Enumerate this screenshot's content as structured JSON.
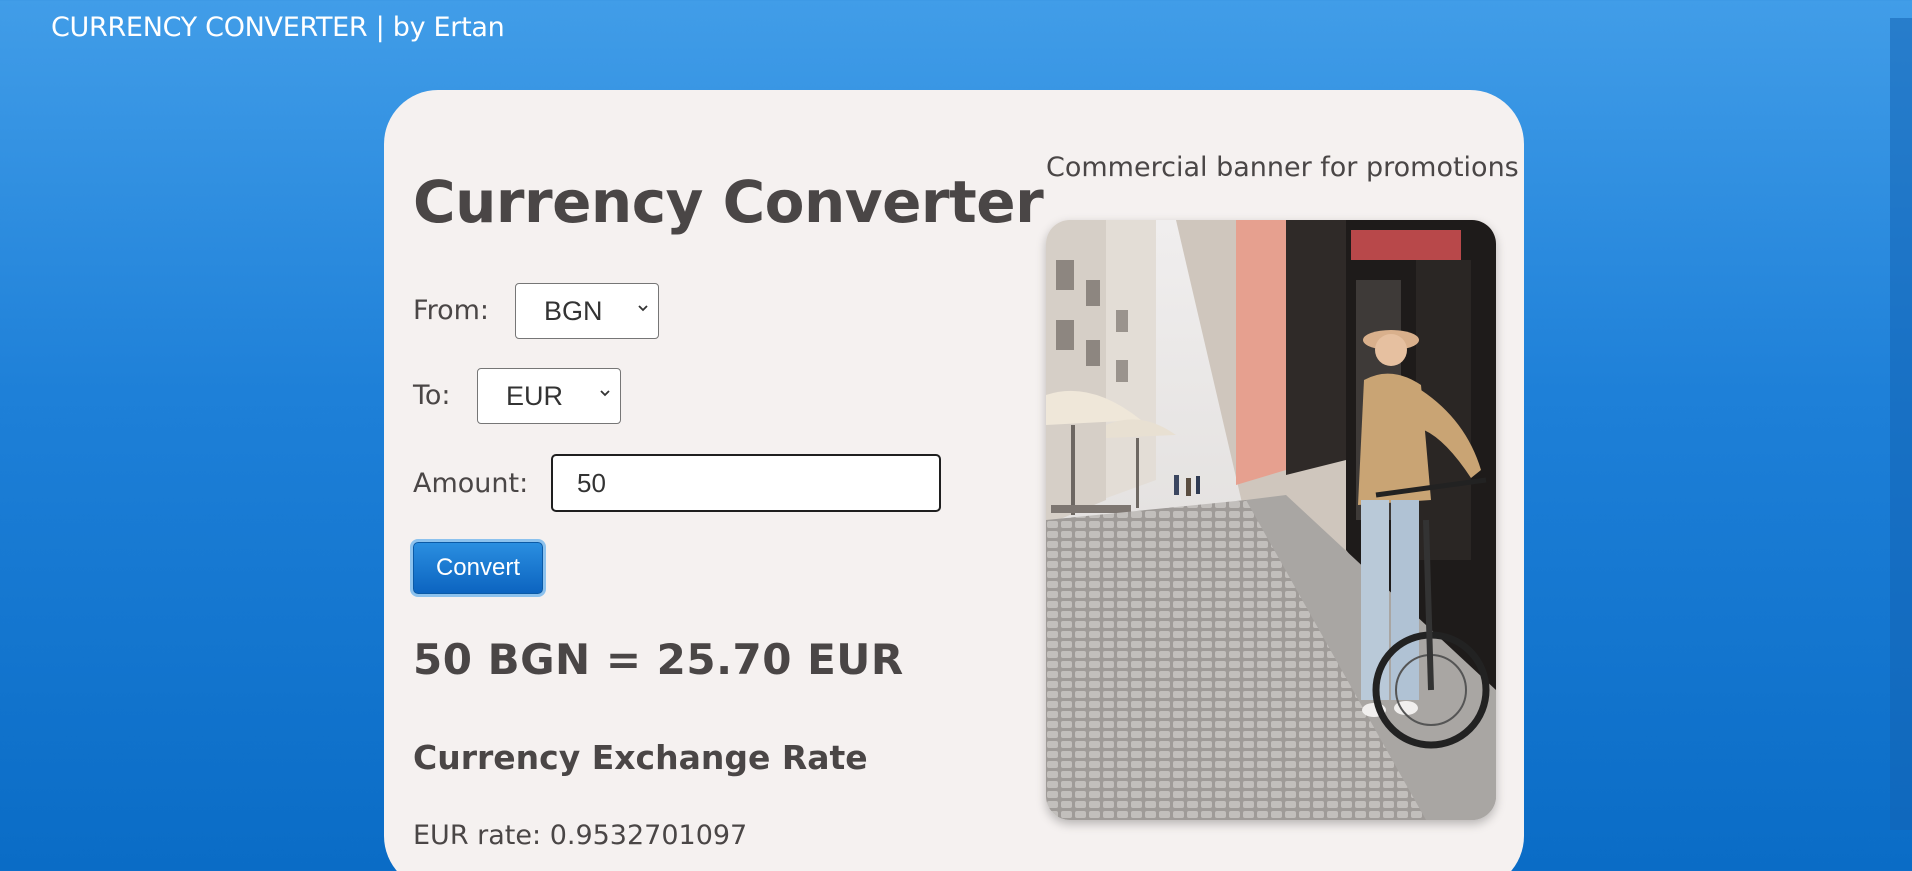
{
  "header": {
    "site_title": "CURRENCY CONVERTER | by Ertan"
  },
  "converter": {
    "heading": "Currency Converter",
    "from_label": "From:",
    "from_value": "BGN",
    "to_label": "To:",
    "to_value": "EUR",
    "amount_label": "Amount:",
    "amount_value": "50",
    "convert_label": "Convert",
    "result_text": "50 BGN = 25.70 EUR",
    "rate_heading": "Currency Exchange Rate",
    "rate_text": "EUR rate: 0.9532701097"
  },
  "banner": {
    "caption": "Commercial banner for promotions",
    "image_subject": "woman-with-bicycle-on-cobblestone-street-photo"
  },
  "colors": {
    "page_gradient_top": "#419de8",
    "page_gradient_bottom": "#0a6cc6",
    "card_background": "#f5f1f0",
    "text": "#4a4646",
    "button": "#0c64c0"
  }
}
